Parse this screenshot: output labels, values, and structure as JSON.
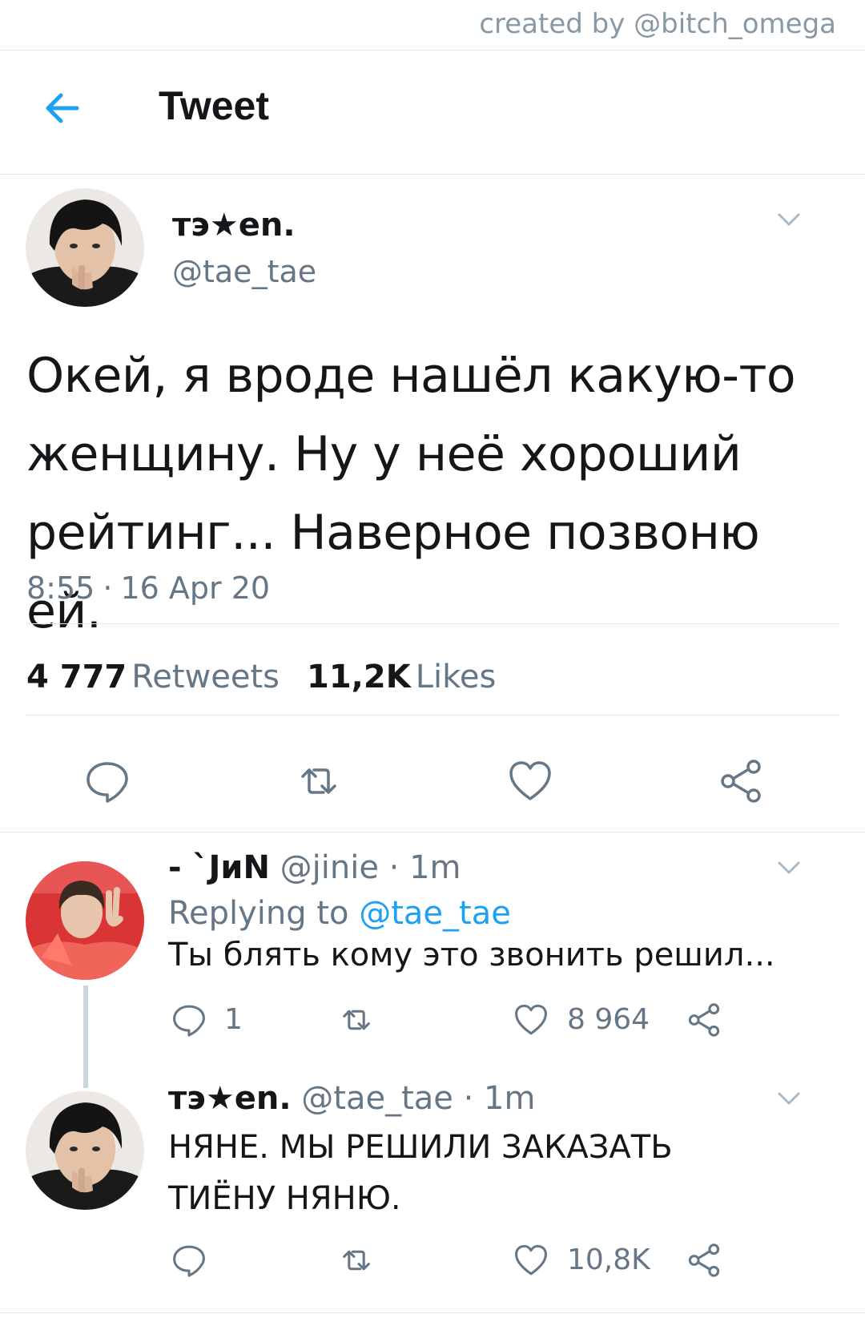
{
  "watermark": "created by @bitch_omega",
  "header": {
    "title": "Tweet",
    "back_icon": "arrow-left-icon"
  },
  "colors": {
    "accent": "#1da1f2",
    "muted": "#657786",
    "divider": "#e1e8ed",
    "text": "#14171a"
  },
  "tweet": {
    "name": "тэ★en.",
    "handle": "@tae_tae",
    "text": "Окей, я вроде нашёл какую-то женщину. Ну у неё хороший рейтинг... Наверное позвоню ей.",
    "time": "8:55",
    "sep": "·",
    "date": "16 Apr 20",
    "retweets_count": "4 777",
    "retweets_label": "Retweets",
    "likes_count": "11,2K",
    "likes_label": "Likes"
  },
  "replies": [
    {
      "name": "- `JиN",
      "handle": "@jinie",
      "meta": "@jinie · 1m",
      "replying_label": "Replying to",
      "replying_to": "@tae_tae",
      "text": "Ты блять кому это звонить решил...",
      "reply_count": "1",
      "retweet_count": "",
      "like_count": "8 964"
    },
    {
      "name": "тэ★en.",
      "handle": "@tae_tae",
      "meta": "@tae_tae · 1m",
      "text": "НЯНЕ. МЫ РЕШИЛИ ЗАКАЗАТЬ ТИЁНУ НЯНЮ.",
      "reply_count": "",
      "retweet_count": "",
      "like_count": "10,8K"
    }
  ]
}
